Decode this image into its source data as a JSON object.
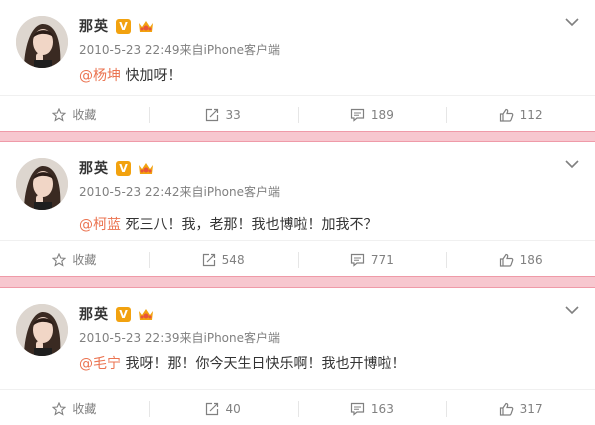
{
  "colors": {
    "mention": "#eb7350",
    "divider": "#f7c7cf",
    "badge": "#f2a20f"
  },
  "posts": [
    {
      "author": "那英",
      "verified_label": "V",
      "timestamp": "2010-5-23 22:49来自iPhone客户端",
      "mention": "@杨坤",
      "text": " 快加呀！",
      "actions": {
        "favorite": "收藏",
        "repost": "33",
        "comment": "189",
        "like": "112"
      }
    },
    {
      "author": "那英",
      "verified_label": "V",
      "timestamp": "2010-5-23 22:42来自iPhone客户端",
      "mention": "@柯蓝",
      "text": " 死三八！我，老那！我也博啦！加我不？",
      "actions": {
        "favorite": "收藏",
        "repost": "548",
        "comment": "771",
        "like": "186"
      }
    },
    {
      "author": "那英",
      "verified_label": "V",
      "timestamp": "2010-5-23 22:39来自iPhone客户端",
      "mention": "@毛宁",
      "text": " 我呀！那！你今天生日快乐啊！我也开博啦！",
      "actions": {
        "favorite": "收藏",
        "repost": "40",
        "comment": "163",
        "like": "317"
      }
    }
  ]
}
